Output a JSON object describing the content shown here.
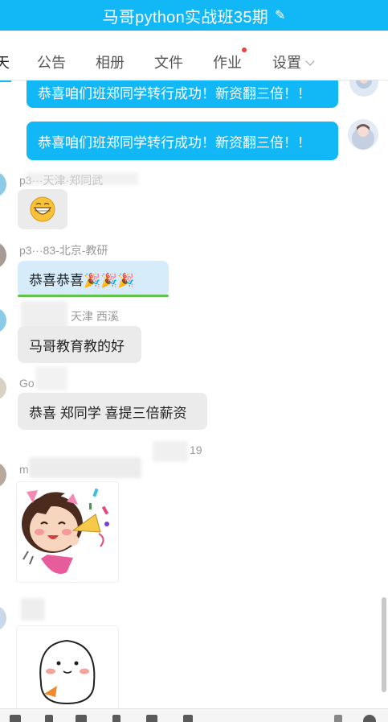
{
  "window": {
    "title": "马哥python实战班35期"
  },
  "tabs": [
    {
      "label": "天"
    },
    {
      "label": "公告"
    },
    {
      "label": "相册"
    },
    {
      "label": "文件"
    },
    {
      "label": "作业"
    },
    {
      "label": "设置"
    }
  ],
  "messages": {
    "m1_text": "恭喜咱们班郑同学转行成功！新资翻三倍！！",
    "m2_text": "恭喜咱们班郑同学转行成功！新资翻三倍！！",
    "m3_nick": "p3···天津·郑同武",
    "m4_nick": "p3···83-北京-教研",
    "m4_text": "恭喜恭喜🎉🎉🎉",
    "m5_nick": "天津  西溪",
    "m5_text": "马哥教育教的好",
    "m6_nick": "Go",
    "m6_text": "恭喜 郑同学 喜提三倍薪资",
    "time_partial": "19",
    "m7_nick": "m",
    "m8_nick": ""
  },
  "colors": {
    "accent": "#12b7f5",
    "bubble_other": "#ebebeb",
    "badge": "#f23d3d"
  }
}
